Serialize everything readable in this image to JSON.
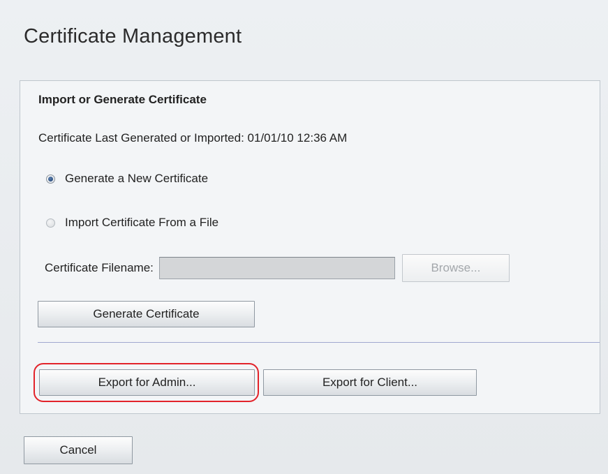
{
  "page": {
    "title": "Certificate Management"
  },
  "panel": {
    "section_title": "Import or Generate Certificate",
    "last_generated": "Certificate Last Generated or Imported: 01/01/10 12:36 AM",
    "options": [
      {
        "label": "Generate a New Certificate",
        "selected": true
      },
      {
        "label": "Import Certificate From a File",
        "selected": false
      }
    ],
    "filename": {
      "label": "Certificate Filename:",
      "value": "",
      "browse_label": "Browse..."
    },
    "generate_button": "Generate Certificate",
    "export_admin_button": "Export for Admin...",
    "export_client_button": "Export for Client..."
  },
  "footer": {
    "cancel_button": "Cancel"
  },
  "colors": {
    "highlight": "#e2232a",
    "selected_radio": "#1f3f6d"
  }
}
